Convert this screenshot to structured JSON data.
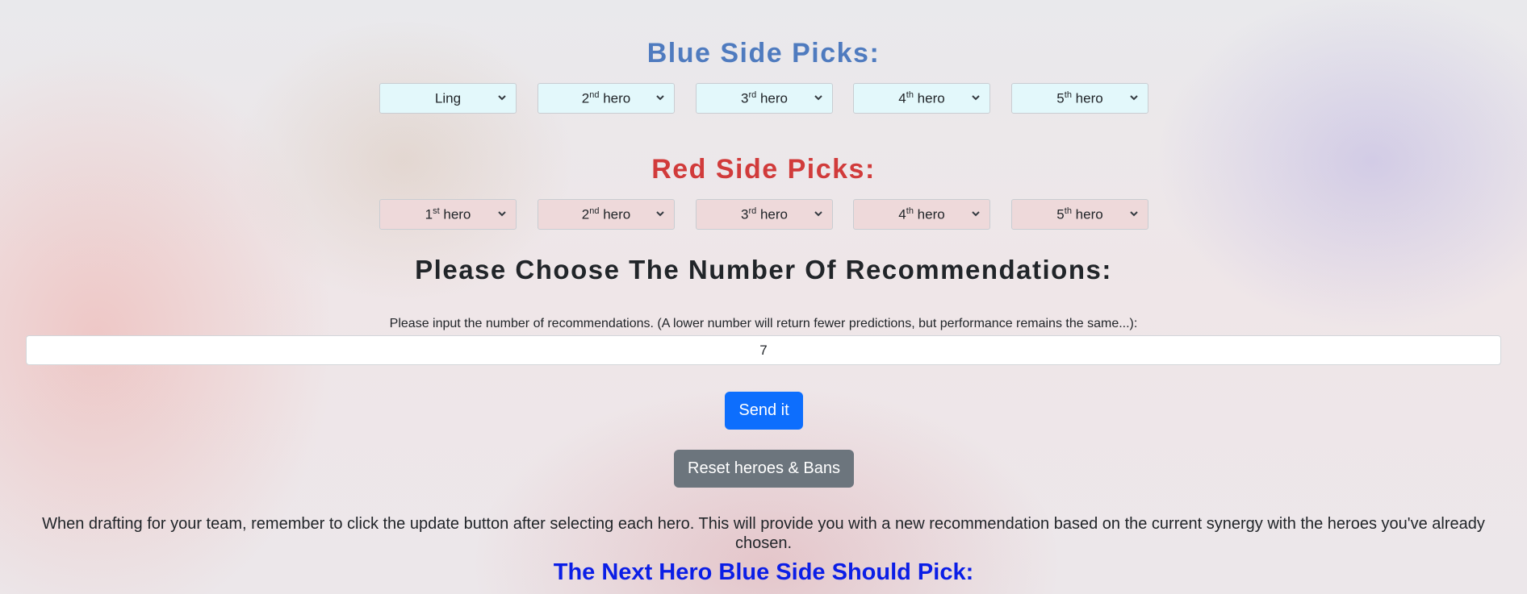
{
  "blue_side": {
    "title": "Blue Side Picks:",
    "picks": [
      {
        "text": "Ling",
        "sup": "",
        "suffix": ""
      },
      {
        "text": "2",
        "sup": "nd",
        "suffix": " hero"
      },
      {
        "text": "3",
        "sup": "rd",
        "suffix": " hero"
      },
      {
        "text": "4",
        "sup": "th",
        "suffix": " hero"
      },
      {
        "text": "5",
        "sup": "th",
        "suffix": " hero"
      }
    ]
  },
  "red_side": {
    "title": "Red Side Picks:",
    "picks": [
      {
        "text": "1",
        "sup": "st",
        "suffix": " hero"
      },
      {
        "text": "2",
        "sup": "nd",
        "suffix": " hero"
      },
      {
        "text": "3",
        "sup": "rd",
        "suffix": " hero"
      },
      {
        "text": "4",
        "sup": "th",
        "suffix": " hero"
      },
      {
        "text": "5",
        "sup": "th",
        "suffix": " hero"
      }
    ]
  },
  "recommendations": {
    "title": "Please Choose The Number Of Recommendations:",
    "label": "Please input the number of recommendations. (A lower number will return fewer predictions, but performance remains the same...):",
    "value": "7"
  },
  "buttons": {
    "send": "Send it",
    "reset": "Reset heroes & Bans"
  },
  "hint": "When drafting for your team, remember to click the update button after selecting each hero. This will provide you with a new recommendation based on the current synergy with the heroes you've already chosen.",
  "next_pick_title": "The Next Hero Blue Side Should Pick:",
  "colors": {
    "blue_title": "#4f7bbf",
    "red_title": "#d13b3b",
    "send_button": "#0d6efd",
    "reset_button": "#6c757d",
    "next_pick_title": "#0b1ee6"
  },
  "icons": {
    "select_arrow": "chevron-down-icon"
  }
}
